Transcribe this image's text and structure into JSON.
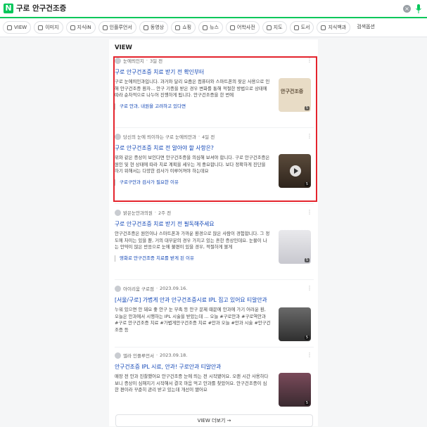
{
  "header": {
    "logo": "N",
    "query": "구로 안구건조증",
    "clear_label": "×"
  },
  "tabs": [
    {
      "label": "VIEW",
      "icon": "view-icon"
    },
    {
      "label": "이미지",
      "icon": "image-icon"
    },
    {
      "label": "지식iN",
      "icon": "qa-icon"
    },
    {
      "label": "인플루언서",
      "icon": "person-icon"
    },
    {
      "label": "동영상",
      "icon": "video-icon"
    },
    {
      "label": "쇼핑",
      "icon": "shopping-icon"
    },
    {
      "label": "뉴스",
      "icon": "news-icon"
    },
    {
      "label": "어학사전",
      "icon": "dictionary-icon"
    },
    {
      "label": "지도",
      "icon": "map-icon"
    },
    {
      "label": "도서",
      "icon": "book-icon"
    },
    {
      "label": "지식백과",
      "icon": "encyclopedia-icon"
    },
    {
      "label": "검색옵션",
      "icon": ""
    }
  ],
  "view": {
    "title": "VIEW",
    "more_label": "VIEW 더보기 →",
    "items": [
      {
        "author": "눈에띄인지",
        "date": "3일 전",
        "title": "구로 안구건조증 치료 받기 전 확인부터",
        "desc": "구로 눈에띄인과입니다. 과거와 달리 요즘은 컴퓨터와 스마트폰의 잦은 사용으로 인해 안구건조증 환자... 안구 기증을 받은 경우 변화를 통해 적절한 방법으로 상태에 따라 순차적으로 나누어 진행하게 됩니다. 안구건조증을 한 번에",
        "thumb_text": "안구건조증",
        "badge": "5",
        "related": "구로 안과, 내원을 고려하고 있다면"
      },
      {
        "author": "당신의 눈에 띄이하는 구로 눈에띄안과",
        "date": "4일 전",
        "title": "구로 안구건조증 치료 전 알아야 할 사항은?",
        "desc": "위와 같은 증상이 보인다면 안구건조증을 의심해 보셔야 합니다. 구로 안구건조증은 원인 및 현 상태에 따라 치료 계획을 세우는 게 중요합니다. 보다 정확하게 진단을 하기 위해서는 다양한 검사가 이루어져야 하는데요",
        "badge": "5",
        "related": "구로구안과 검사가 필요한 이유"
      },
      {
        "author": "밝은눈안과의원",
        "date": "2주 전",
        "title": "구로 안구건조증 치료 받기 전 필독해주세요",
        "desc": "안구건조증은 원인이나 스마트폰과 가까운 환경으로 많은 사람이 경험합니다. 그 정도에 차이는 있을 뿐, 거의 대부분의 경우 가지고 있는 흔한 증상인데요. 눈물이 나는 안약이 많은 반응으로 눈에 불편이 있을 경우, 적절하게 볼게",
        "badge": "5",
        "related": "영화로 안구건조증 치료를 받게 된 이유"
      },
      {
        "author": "아이리움 구로점",
        "date": "2023.09.16.",
        "title": "[서울/구로] 가볍게 안과 안구건조증시료 IPL 집고 있어요 티알안과",
        "desc": "누워 있으면 안 돼요 좋 안구 눈 부족 등 안구 문제 때문에 안과에 가기 어려운 환, 오늘은 안과에서 시행하는 IPL 시술을 받았는데 ... 오늘 #구로안과 #구로역안과 #구로 안구건조증 치료 #가볍게안구건조증 치료 #안과 오늘 #안과 시술 #안구건조증 등",
        "badge": "5"
      },
      {
        "author": "엘라 인플루언서",
        "date": "2023.09.18.",
        "title": "안구건조증 IPL 시료, 안과! 구로안과 티알안과",
        "desc": "매장 전 안과 진찰했어요 안구건조증 눈에 띄는 전 시작됐어요. 오랜 시간 사용하다 보니 증상이 심해지기 시작해서 결국 마음 먹고 안과를 찾았어요. 안구건조증이 심한 편이라 꾸준히 관리 받고 있는데 개선이 됐어요",
        "badge": "5"
      }
    ]
  }
}
